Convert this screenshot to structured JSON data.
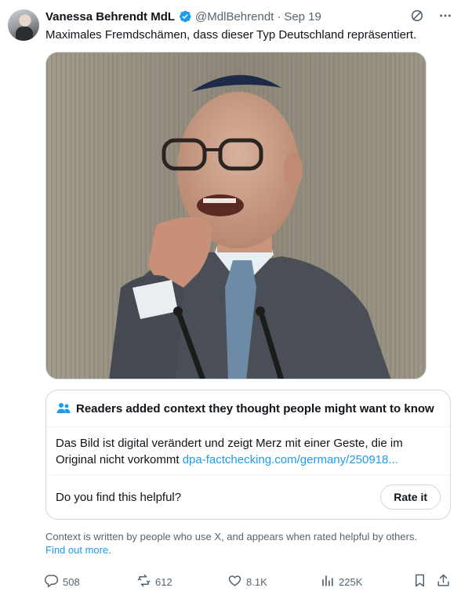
{
  "tweet": {
    "author_name": "Vanessa Behrendt MdL",
    "handle": "@MdlBehrendt",
    "separator": "·",
    "date": "Sep 19",
    "text": "Maximales Fremdschämen, dass dieser Typ Deutschland repräsentiert."
  },
  "community_note": {
    "title": "Readers added context they thought people might want to know",
    "body": "Das Bild ist digital verändert und zeigt Merz mit einer Geste, die im Original nicht vorkommt",
    "link_text": "dpa-factchecking.com/germany/250918...",
    "question": "Do you find this helpful?",
    "rate_label": "Rate it"
  },
  "context_info": {
    "text": "Context is written by people who use X, and appears when rated helpful by others.",
    "link_text": "Find out more",
    "suffix": "."
  },
  "actions": {
    "replies": "508",
    "reposts": "612",
    "likes": "8.1K",
    "views": "225K"
  },
  "icons": {
    "verified": "verified-badge-icon",
    "grok": "grok-icon",
    "more": "more-icon",
    "people": "people-icon",
    "reply": "reply-icon",
    "repost": "repost-icon",
    "like": "heart-icon",
    "views": "views-icon",
    "bookmark": "bookmark-icon",
    "share": "share-icon"
  },
  "colors": {
    "link": "#1d9bf0",
    "secondary_text": "#536471",
    "verified": "#1d9bf0"
  }
}
